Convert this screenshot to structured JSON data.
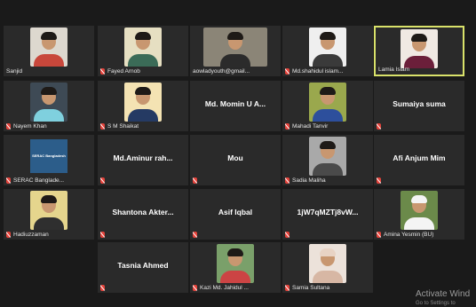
{
  "participants": [
    {
      "name": "Sanjid",
      "display": "Sanjid",
      "video": true,
      "muted": false,
      "shirt": "#c8473b",
      "bg": "#ddd8cf"
    },
    {
      "name": "Fayed Arnob",
      "display": "Fayed Arnob",
      "video": true,
      "muted": true,
      "shirt": "#3b6b57",
      "bg": "#e6dfc2"
    },
    {
      "name": "aowladyouth@gmail...",
      "display": "aowladyouth@gmail...",
      "video": true,
      "muted": false,
      "shirt": "#2b2b2b",
      "bg": "#8b8577"
    },
    {
      "name": "Md.shahidul islam...",
      "display": "Md.shahidul islam...",
      "video": true,
      "muted": true,
      "shirt": "#3a3a3a",
      "bg": "#efefef"
    },
    {
      "name": "Lamia Islam",
      "display": "Lamia Islam",
      "video": true,
      "muted": false,
      "shirt": "#6b1f3a",
      "bg": "#f0e9e3"
    },
    {
      "name": "Nayem Khan",
      "display": "Nayem Khan",
      "video": true,
      "muted": true,
      "shirt": "#7fd0de",
      "bg": "#3e4a55"
    },
    {
      "name": "S M Shaikat",
      "display": "S M Shaikat",
      "video": true,
      "muted": true,
      "shirt": "#253a63",
      "bg": "#f4e3b3"
    },
    {
      "name": "Md. Momin U A...",
      "display": "Md. Momin U A...",
      "video": false,
      "muted": false
    },
    {
      "name": "Mahadi Tanvir",
      "display": "Mahadi Tanvir",
      "video": true,
      "muted": true,
      "shirt": "#2d4f9c",
      "bg": "#9aa84d"
    },
    {
      "name": "Sumaiya suma",
      "display": "Sumaiya suma",
      "video": false,
      "muted": true
    },
    {
      "name": "SERAC Banglade...",
      "display": "SERAC Banglade...",
      "video": true,
      "muted": true,
      "logo": "SERAC Bangladesh"
    },
    {
      "name": "Md.Aminur rah...",
      "display": "Md.Aminur rah...",
      "video": false,
      "muted": true
    },
    {
      "name": "Mou",
      "display": "Mou",
      "video": false,
      "muted": true
    },
    {
      "name": "Sadia Maliha",
      "display": "Sadia Maliha",
      "video": true,
      "muted": true,
      "shirt": "#4a4a4a",
      "bg": "#a9a9a9"
    },
    {
      "name": "Afi Anjum Mim",
      "display": "Afi Anjum Mim",
      "video": false,
      "muted": true
    },
    {
      "name": "Hadiuzzaman",
      "display": "Hadiuzzaman",
      "video": true,
      "muted": true,
      "shirt": "#2f2f2f",
      "bg": "#e5d58d"
    },
    {
      "name": "Shantona Akter...",
      "display": "Shantona Akter...",
      "video": false,
      "muted": true
    },
    {
      "name": "Asif Iqbal",
      "display": "Asif Iqbal",
      "video": false,
      "muted": true
    },
    {
      "name": "1jW7qMZTj8vW...",
      "display": "1jW7qMZTj8vW...",
      "video": false,
      "muted": true
    },
    {
      "name": "Amina Yesmin (BU)",
      "display": "Amina Yesmin (BU)",
      "video": true,
      "muted": true,
      "shirt": "#f4f4f4",
      "bg": "#6b8a4a"
    },
    {
      "name": "Tasnia Ahmed",
      "display": "Tasnia Ahmed",
      "video": false,
      "muted": true
    },
    {
      "name": "Kazi Md. Jahidul ...",
      "display": "Kazi Md. Jahidul ...",
      "video": true,
      "muted": true,
      "shirt": "#c44",
      "bg": "#7aa06a"
    },
    {
      "name": "Samia Sultana",
      "display": "Samia Sultana",
      "video": true,
      "muted": true,
      "shirt": "#d7b7a4",
      "bg": "#ece2da"
    }
  ],
  "watermark": {
    "title": "Activate Wind",
    "subtitle": "Go to Settings to"
  }
}
